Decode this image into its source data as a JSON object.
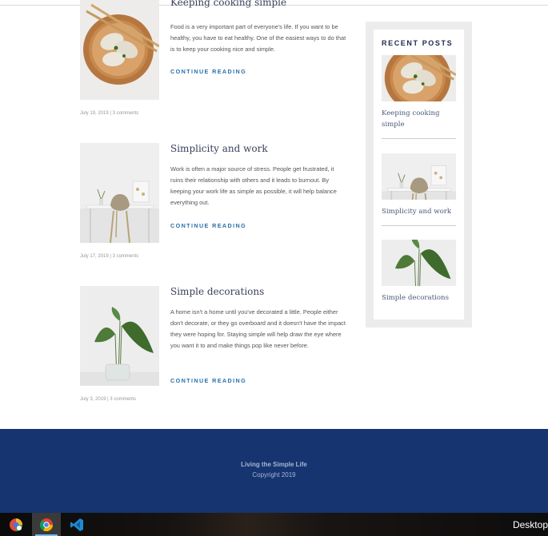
{
  "posts": [
    {
      "title": "Keeping cooking simple",
      "excerpt": "Food is a very important part of everyone's life. If you want to be healthy, you have to eat healthy. One of the easiest ways to do that is to keep your cooking nice and simple.",
      "link": "CONTINUE READING",
      "meta": "July 19, 2019 | 3 comments",
      "image": "dumplings-bowl-image"
    },
    {
      "title": "Simplicity and work",
      "excerpt": "Work is often a major source of stress. People get frustrated, it ruins their relationship with others and it leads to burnout. By keeping your work life as simple as possible, it will help balance everything out.",
      "link": "CONTINUE READING",
      "meta": "July 17, 2019 | 3 comments",
      "image": "desk-chair-image"
    },
    {
      "title": "Simple decorations",
      "excerpt": "A home isn't a home until you've decorated a little. People either don't decorate, or they go overboard and it doesn't have the impact they were hoping for. Staying simple will help draw the eye where you want it to and make things pop like never before.",
      "link": "CONTINUE READING",
      "meta": "July 3, 2019 | 3 comments",
      "image": "plant-vase-image"
    }
  ],
  "sidebar": {
    "heading": "RECENT POSTS",
    "items": [
      {
        "title": "Keeping cooking simple"
      },
      {
        "title": "Simplicity and work"
      },
      {
        "title": "Simple decorations"
      }
    ]
  },
  "footer": {
    "line1": "Living the Simple Life",
    "line2": "Copyright 2019"
  },
  "taskbar": {
    "apps": [
      "app-icon",
      "chrome-icon",
      "vscode-icon"
    ],
    "desktop_label": "Desktop"
  },
  "colors": {
    "footer_bg": "#153470",
    "link": "#2a6fa8",
    "title": "#3a3f5a"
  }
}
